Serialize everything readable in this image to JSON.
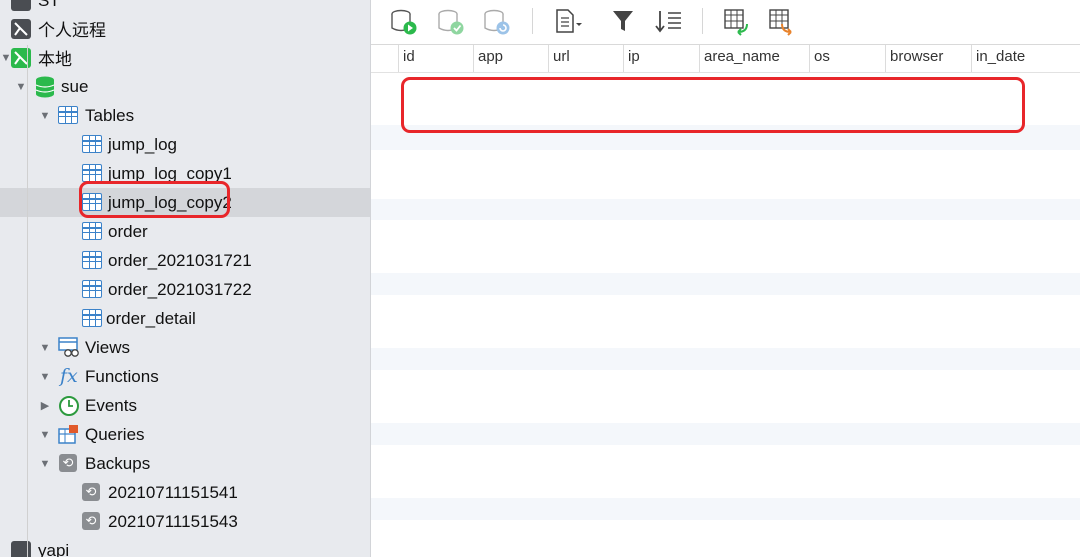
{
  "sidebar": {
    "connection_top": "ST",
    "personal_remote": "个人远程",
    "local": "本地",
    "database": "sue",
    "tables_label": "Tables",
    "tables": [
      "jump_log",
      "jump_log_copy1",
      "jump_log_copy2",
      "order",
      "order_2021031721",
      "order_2021031722",
      "order_detail"
    ],
    "selected_table": "jump_log_copy2",
    "views_label": "Views",
    "functions_label": "Functions",
    "events_label": "Events",
    "queries_label": "Queries",
    "backups_label": "Backups",
    "backups": [
      "20210711151541",
      "20210711151543"
    ],
    "bottom_connection": "yapi"
  },
  "toolbar": {
    "icons": [
      "db-run-icon",
      "db-check-icon",
      "db-refresh-icon",
      "document-menu-icon",
      "filter-icon",
      "sort-icon",
      "table-import-icon",
      "table-export-icon"
    ]
  },
  "grid": {
    "columns": [
      "id",
      "app",
      "url",
      "ip",
      "area_name",
      "os",
      "browser",
      "in_date"
    ],
    "rows": []
  },
  "colors": {
    "highlight": "#e8262a",
    "stripe": "#f4f7fb",
    "accent": "#3b82c9"
  }
}
